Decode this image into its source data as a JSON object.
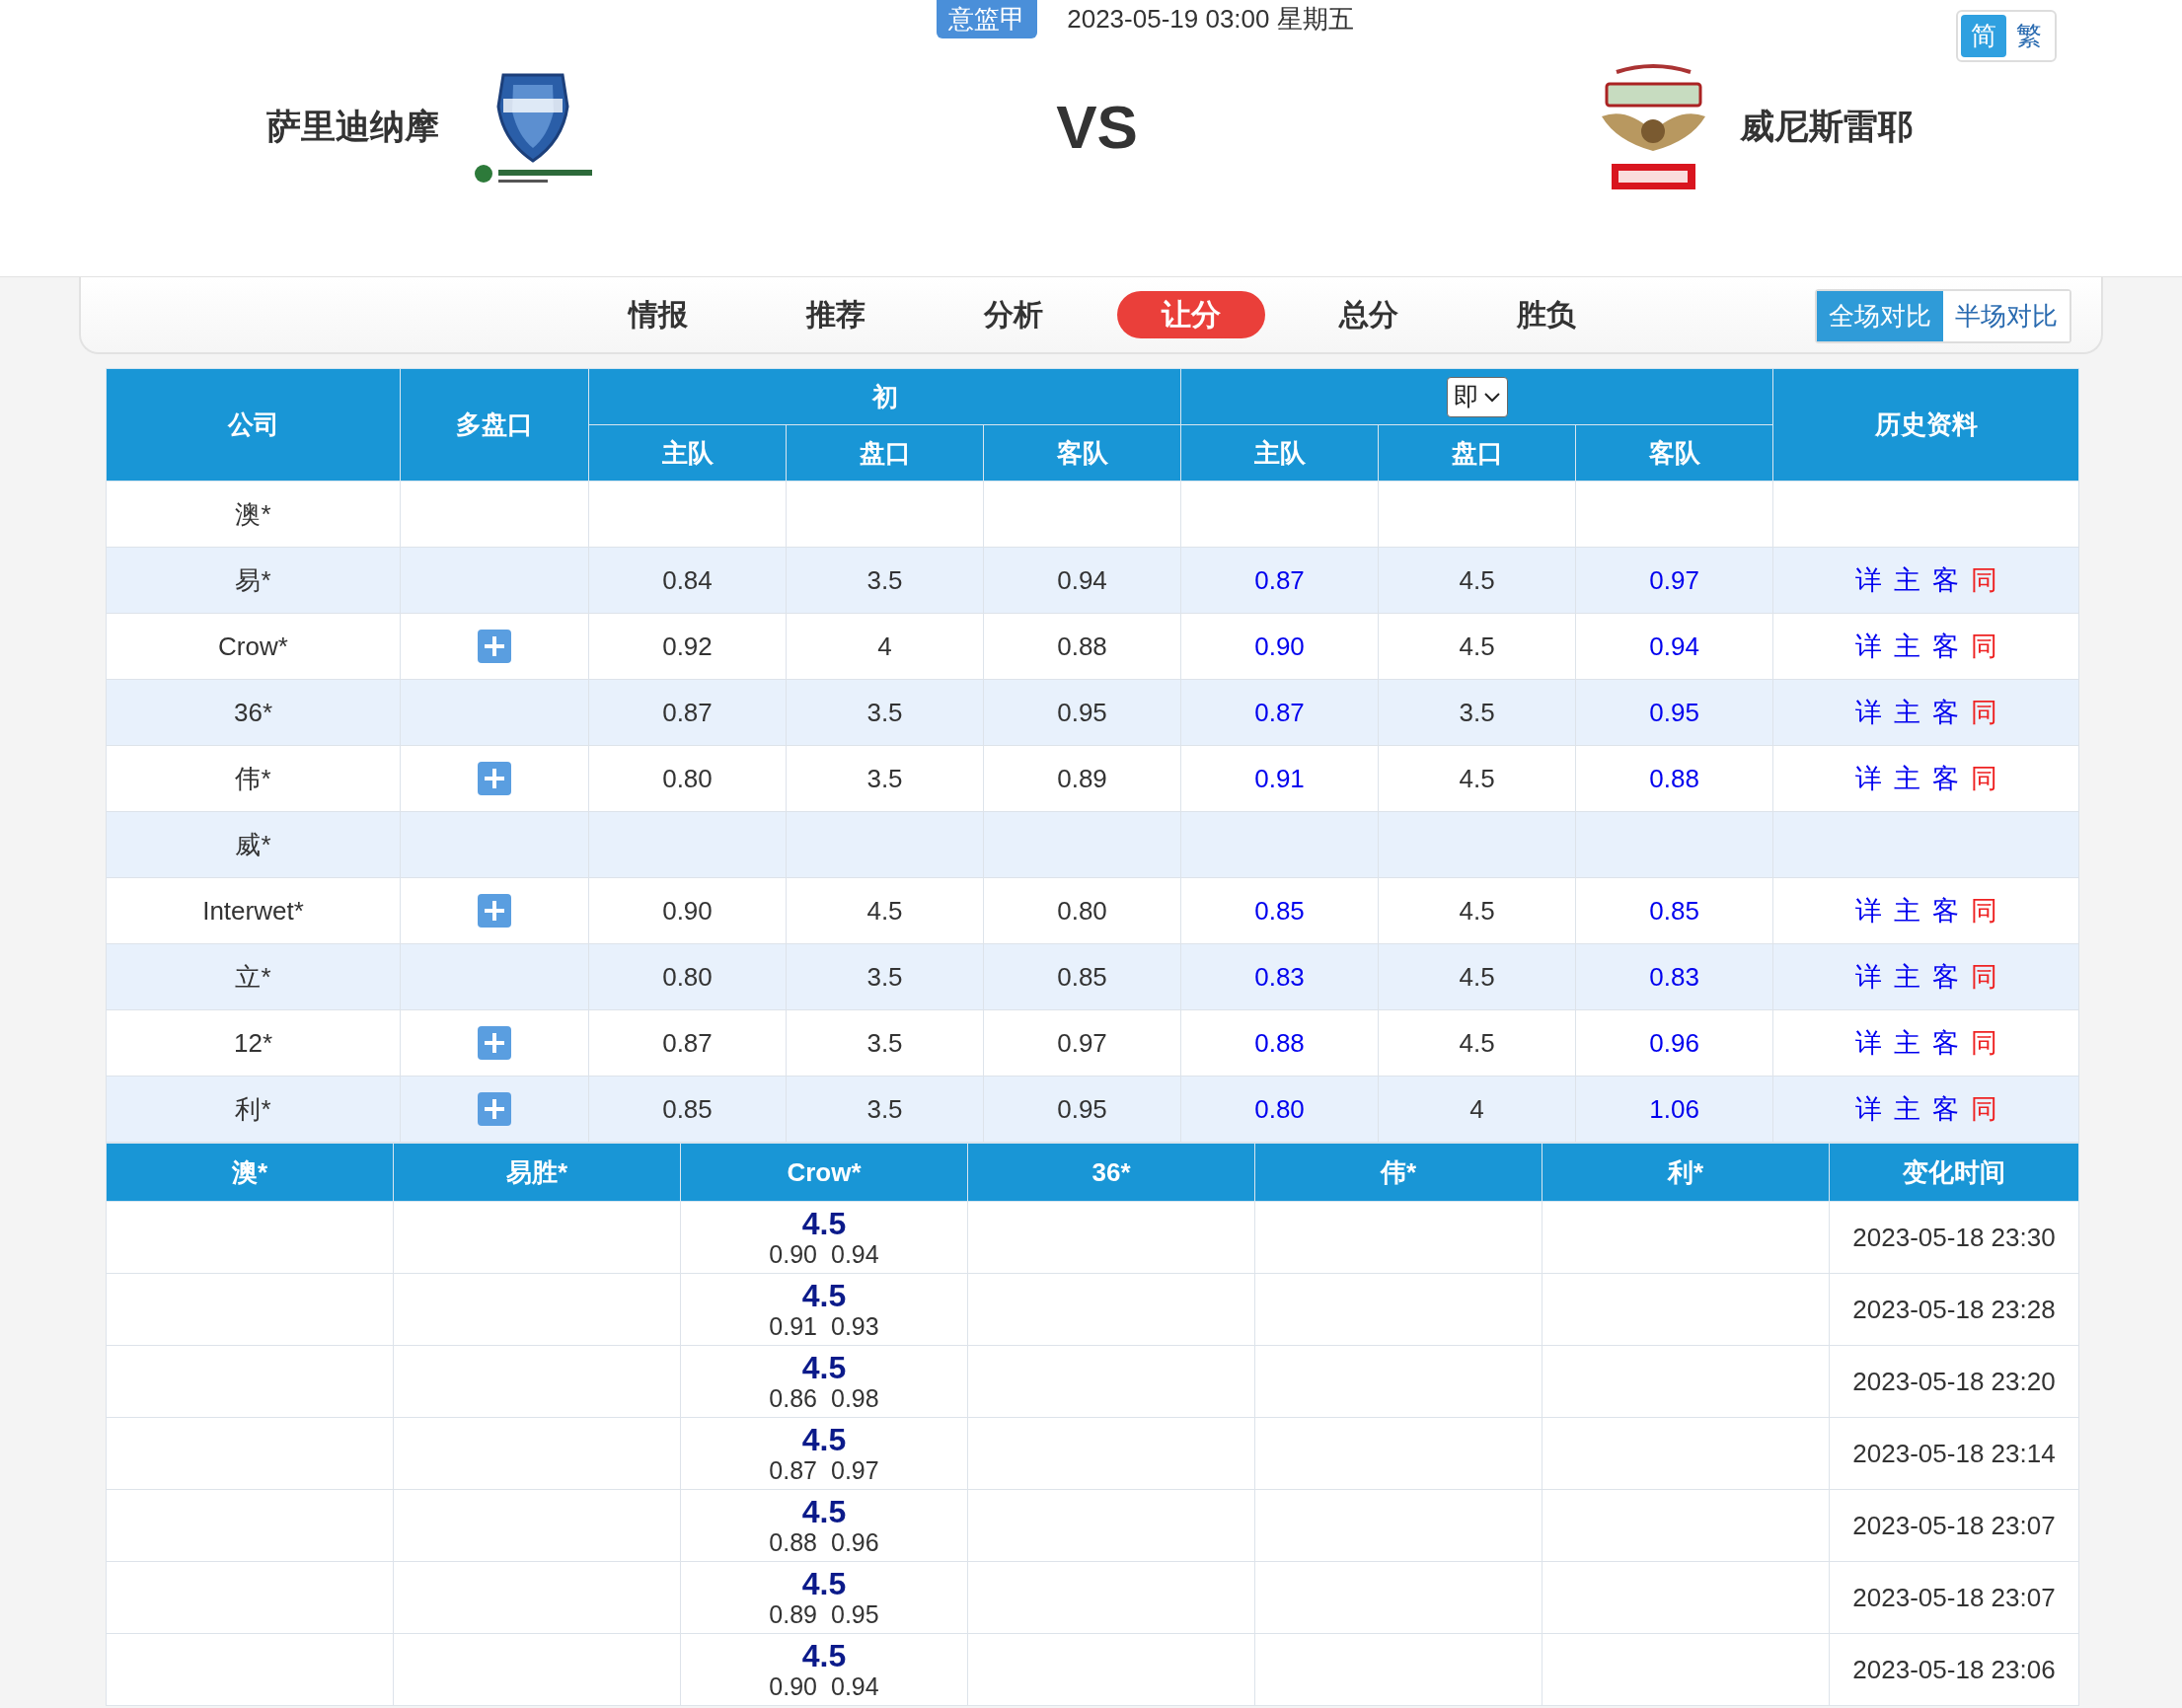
{
  "match": {
    "league": "意篮甲",
    "datetime": "2023-05-19 03:00 星期五",
    "home_team": "萨里迪纳摩",
    "vs": "VS",
    "away_team": "威尼斯雷耶"
  },
  "language_toggle": [
    {
      "label": "简",
      "selected": true
    },
    {
      "label": "繁",
      "selected": false
    }
  ],
  "tabs": [
    {
      "label": "情报",
      "selected": false
    },
    {
      "label": "推荐",
      "selected": false
    },
    {
      "label": "分析",
      "selected": false
    },
    {
      "label": "让分",
      "selected": true
    },
    {
      "label": "总分",
      "selected": false
    },
    {
      "label": "胜负",
      "selected": false
    }
  ],
  "compare_toggle": [
    {
      "label": "全场对比",
      "selected": true
    },
    {
      "label": "半场对比",
      "selected": false
    }
  ],
  "odds_table": {
    "columns": {
      "company": "公司",
      "multi": "多盘口",
      "initial": "初",
      "live_select": "即",
      "history": "历史资料",
      "sub": [
        "主队",
        "盘口",
        "客队",
        "主队",
        "盘口",
        "客队"
      ]
    },
    "rows": [
      {
        "company": "澳*",
        "multi": false,
        "initial": [],
        "live": [],
        "links": []
      },
      {
        "company": "易*",
        "multi": false,
        "initial": [
          "0.84",
          "3.5",
          "0.94"
        ],
        "live": [
          "0.87",
          "4.5",
          "0.97"
        ],
        "links": [
          {
            "label": "详",
            "color": "#0000ee"
          },
          {
            "label": "主",
            "color": "#0000ee"
          },
          {
            "label": "客",
            "color": "#0000ee"
          },
          {
            "label": "同",
            "color": "#ee2222"
          }
        ]
      },
      {
        "company": "Crow*",
        "multi": true,
        "initial": [
          "0.92",
          "4",
          "0.88"
        ],
        "live": [
          "0.90",
          "4.5",
          "0.94"
        ],
        "links": [
          {
            "label": "详",
            "color": "#0000ee"
          },
          {
            "label": "主",
            "color": "#0000ee"
          },
          {
            "label": "客",
            "color": "#0000ee"
          },
          {
            "label": "同",
            "color": "#ee2222"
          }
        ]
      },
      {
        "company": "36*",
        "multi": false,
        "initial": [
          "0.87",
          "3.5",
          "0.95"
        ],
        "live": [
          "0.87",
          "3.5",
          "0.95"
        ],
        "links": [
          {
            "label": "详",
            "color": "#0000ee"
          },
          {
            "label": "主",
            "color": "#0000ee"
          },
          {
            "label": "客",
            "color": "#0000ee"
          },
          {
            "label": "同",
            "color": "#ee2222"
          }
        ]
      },
      {
        "company": "伟*",
        "multi": true,
        "initial": [
          "0.80",
          "3.5",
          "0.89"
        ],
        "live": [
          "0.91",
          "4.5",
          "0.88"
        ],
        "links": [
          {
            "label": "详",
            "color": "#0000ee"
          },
          {
            "label": "主",
            "color": "#0000ee"
          },
          {
            "label": "客",
            "color": "#0000ee"
          },
          {
            "label": "同",
            "color": "#ee2222"
          }
        ]
      },
      {
        "company": "威*",
        "multi": false,
        "initial": [],
        "live": [],
        "links": []
      },
      {
        "company": "Interwet*",
        "multi": true,
        "initial": [
          "0.90",
          "4.5",
          "0.80"
        ],
        "live": [
          "0.85",
          "4.5",
          "0.85"
        ],
        "links": [
          {
            "label": "详",
            "color": "#0000ee"
          },
          {
            "label": "主",
            "color": "#0000ee"
          },
          {
            "label": "客",
            "color": "#0000ee"
          },
          {
            "label": "同",
            "color": "#ee2222"
          }
        ]
      },
      {
        "company": "立*",
        "multi": false,
        "initial": [
          "0.80",
          "3.5",
          "0.85"
        ],
        "live": [
          "0.83",
          "4.5",
          "0.83"
        ],
        "links": [
          {
            "label": "详",
            "color": "#0000ee"
          },
          {
            "label": "主",
            "color": "#0000ee"
          },
          {
            "label": "客",
            "color": "#0000ee"
          },
          {
            "label": "同",
            "color": "#ee2222"
          }
        ]
      },
      {
        "company": "12*",
        "multi": true,
        "initial": [
          "0.87",
          "3.5",
          "0.97"
        ],
        "live": [
          "0.88",
          "4.5",
          "0.96"
        ],
        "links": [
          {
            "label": "详",
            "color": "#0000ee"
          },
          {
            "label": "主",
            "color": "#0000ee"
          },
          {
            "label": "客",
            "color": "#0000ee"
          },
          {
            "label": "同",
            "color": "#ee2222"
          }
        ]
      },
      {
        "company": "利*",
        "multi": true,
        "initial": [
          "0.85",
          "3.5",
          "0.95"
        ],
        "live": [
          "0.80",
          "4",
          "1.06"
        ],
        "links": [
          {
            "label": "详",
            "color": "#0000ee"
          },
          {
            "label": "主",
            "color": "#0000ee"
          },
          {
            "label": "客",
            "color": "#0000ee"
          },
          {
            "label": "同",
            "color": "#ee2222"
          }
        ]
      }
    ]
  },
  "change_table": {
    "columns": [
      "澳*",
      "易胜*",
      "Crow*",
      "36*",
      "伟*",
      "利*",
      "变化时间"
    ],
    "rows": [
      {
        "crow_line": "4.5",
        "crow_home": "0.90",
        "crow_away": "0.94",
        "time": "2023-05-18 23:30"
      },
      {
        "crow_line": "4.5",
        "crow_home": "0.91",
        "crow_away": "0.93",
        "time": "2023-05-18 23:28"
      },
      {
        "crow_line": "4.5",
        "crow_home": "0.86",
        "crow_away": "0.98",
        "time": "2023-05-18 23:20"
      },
      {
        "crow_line": "4.5",
        "crow_home": "0.87",
        "crow_away": "0.97",
        "time": "2023-05-18 23:14"
      },
      {
        "crow_line": "4.5",
        "crow_home": "0.88",
        "crow_away": "0.96",
        "time": "2023-05-18 23:07"
      },
      {
        "crow_line": "4.5",
        "crow_home": "0.89",
        "crow_away": "0.95",
        "time": "2023-05-18 23:07"
      },
      {
        "crow_line": "4.5",
        "crow_home": "0.90",
        "crow_away": "0.94",
        "time": "2023-05-18 23:06"
      }
    ]
  }
}
